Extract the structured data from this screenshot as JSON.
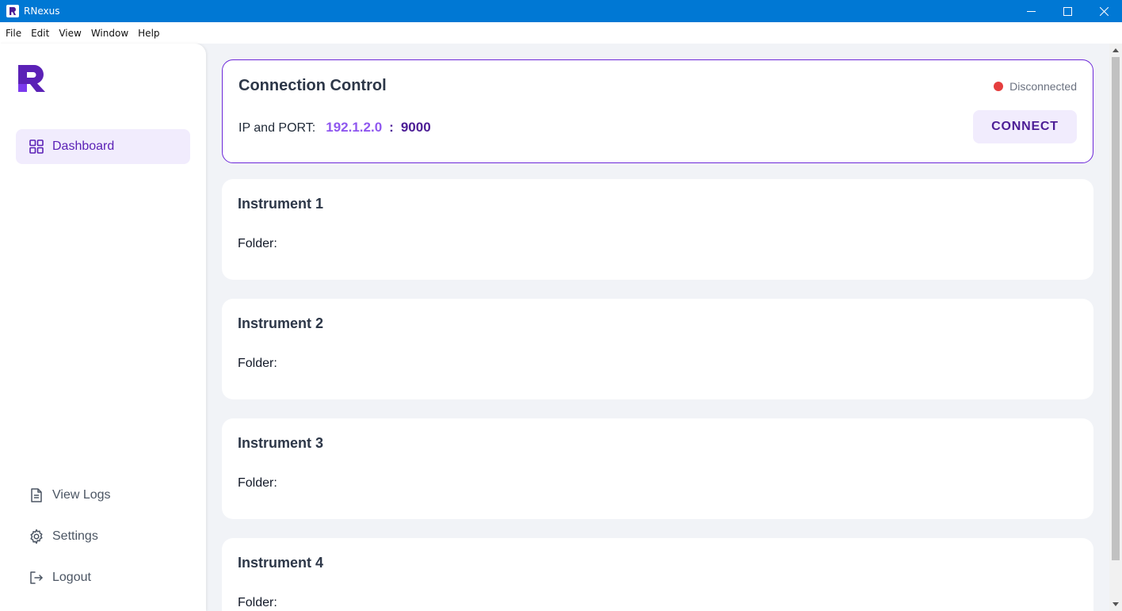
{
  "window": {
    "title": "RNexus",
    "controls": [
      "minimize-icon",
      "maximize-icon",
      "close-icon"
    ]
  },
  "menubar": {
    "items": [
      "File",
      "Edit",
      "View",
      "Window",
      "Help"
    ]
  },
  "sidebar": {
    "logo_icon": "rnexus-logo",
    "nav": [
      {
        "label": "Dashboard",
        "icon": "grid-icon",
        "active": true
      }
    ],
    "bottom": [
      {
        "label": "View Logs",
        "icon": "document-icon"
      },
      {
        "label": "Settings",
        "icon": "gear-icon"
      },
      {
        "label": "Logout",
        "icon": "logout-icon"
      }
    ]
  },
  "connection": {
    "title": "Connection Control",
    "status": "Disconnected",
    "status_color": "#e53e3e",
    "ip_label": "IP and PORT:",
    "ip": "192.1.2.0",
    "separator": ":",
    "port": "9000",
    "connect_label": "CONNECT"
  },
  "instruments": [
    {
      "title": "Instrument 1",
      "folder_label": "Folder:"
    },
    {
      "title": "Instrument 2",
      "folder_label": "Folder:"
    },
    {
      "title": "Instrument 3",
      "folder_label": "Folder:"
    },
    {
      "title": "Instrument 4",
      "folder_label": "Folder:"
    }
  ],
  "colors": {
    "titlebar": "#0078d4",
    "accent": "#6d28d9",
    "active_nav_bg": "#f1ecfd",
    "background": "#f1f3f7"
  }
}
